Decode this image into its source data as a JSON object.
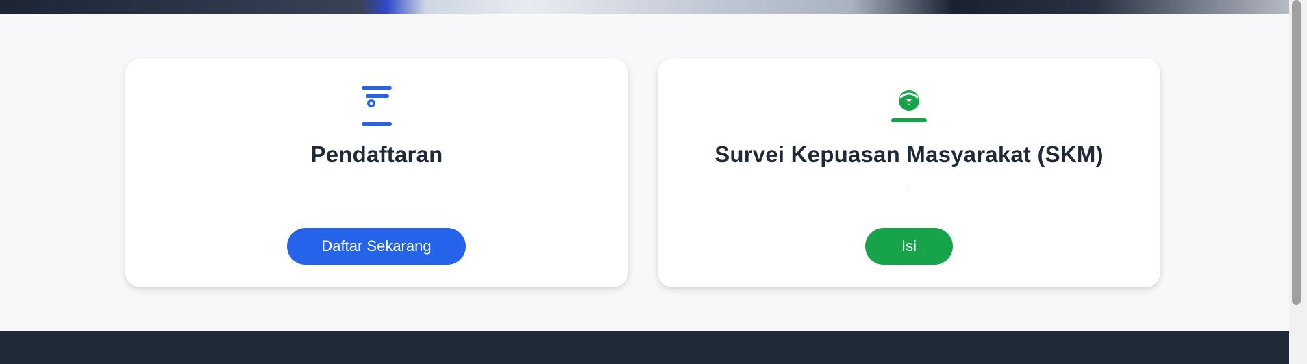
{
  "cards": [
    {
      "icon": "registration-form-icon",
      "title": "Pendaftaran",
      "description": "",
      "button_label": "Daftar Sekarang",
      "accent_color": "#2563eb"
    },
    {
      "icon": "survey-check-badge-icon",
      "title": "Survei Kepuasan Masyarakat (SKM)",
      "description": ".",
      "button_label": "Isi",
      "accent_color": "#16a34a"
    }
  ],
  "colors": {
    "page_background": "#f7f8fa",
    "card_background": "#ffffff",
    "title_text": "#1f2937",
    "footer_background": "#1f2937"
  }
}
